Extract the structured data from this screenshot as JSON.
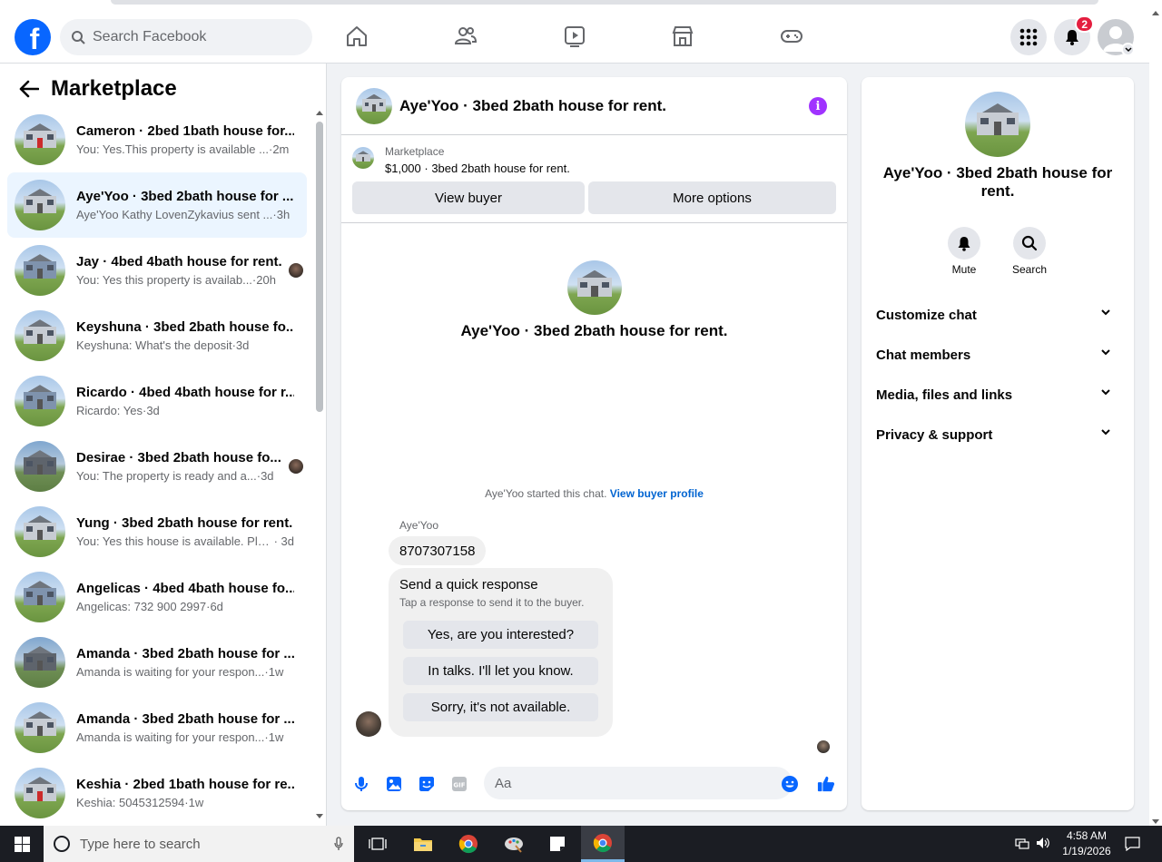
{
  "nav": {
    "search_placeholder": "Search Facebook",
    "notification_count": "2",
    "logo_letter": "f"
  },
  "sidebar": {
    "title": "Marketplace",
    "conversations": [
      {
        "name": "Cameron · 2bed 1bath house for...",
        "preview": "You: Yes.This property is available ...",
        "time": " ·2m",
        "house": "red",
        "active": false,
        "seen": false
      },
      {
        "name": "Aye'Yoo · 3bed 2bath house for ...",
        "preview": "Aye'Yoo Kathy LovenZykavius sent ...",
        "time": " ·3h",
        "house": "gray",
        "active": true,
        "seen": false
      },
      {
        "name": "Jay · 4bed 4bath house for rent.",
        "preview": "You: Yes this property is availab...",
        "time": " ·20h",
        "house": "blue",
        "active": false,
        "seen": true
      },
      {
        "name": "Keyshuna · 3bed 2bath house fo...",
        "preview": "Keyshuna: What's the deposit",
        "time": " ·3d",
        "house": "gray",
        "active": false,
        "seen": false
      },
      {
        "name": "Ricardo · 4bed 4bath house for r...",
        "preview": "Ricardo: Yes",
        "time": " ·3d",
        "house": "blue",
        "active": false,
        "seen": false
      },
      {
        "name": "Desirae · 3bed 2bath house fo...",
        "preview": "You: The property is ready and a...",
        "time": " ·3d",
        "house": "dark",
        "active": false,
        "seen": true
      },
      {
        "name": "Yung · 3bed 2bath house for rent.",
        "preview": "You: Yes this house is available. Ple...",
        "time": " · 3d",
        "house": "gray",
        "active": false,
        "seen": false
      },
      {
        "name": "Angelicas · 4bed 4bath house fo...",
        "preview": "Angelicas: 732 900 2997",
        "time": " ·6d",
        "house": "blue",
        "active": false,
        "seen": false
      },
      {
        "name": "Amanda · 3bed 2bath house for ...",
        "preview": "Amanda is waiting for your respon...",
        "time": " ·1w",
        "house": "dark",
        "active": false,
        "seen": false
      },
      {
        "name": "Amanda · 3bed 2bath house for ...",
        "preview": "Amanda is waiting for your respon...",
        "time": " ·1w",
        "house": "gray",
        "active": false,
        "seen": false
      },
      {
        "name": "Keshia · 2bed 1bath house for re...",
        "preview": "Keshia: 5045312594",
        "time": " ·1w",
        "house": "red",
        "active": false,
        "seen": false
      }
    ]
  },
  "chat": {
    "title": "Aye'Yoo · 3bed 2bath house for rent.",
    "listing_category": "Marketplace",
    "listing_price": "$1,000 · 3bed 2bath house for rent.",
    "view_buyer": "View buyer",
    "more_options": "More options",
    "intro_title": "Aye'Yoo · 3bed 2bath house for rent.",
    "started_text": "Aye'Yoo started this chat. ",
    "view_buyer_profile": "View buyer profile",
    "sender_name": "Aye'Yoo",
    "message": "8707307158",
    "quick_title": "Send a quick response",
    "quick_subtitle": "Tap a response to send it to the buyer.",
    "quick_options": [
      "Yes, are you interested?",
      "In talks. I'll let you know.",
      "Sorry, it's not available."
    ],
    "composer_placeholder": "Aa"
  },
  "details": {
    "title": "Aye'Yoo · 3bed 2bath house for rent.",
    "mute": "Mute",
    "search": "Search",
    "sections": [
      "Customize chat",
      "Chat members",
      "Media, files and links",
      "Privacy & support"
    ]
  },
  "taskbar": {
    "search_placeholder": "Type here to search",
    "time": "4:58 AM",
    "date": "1/19/2026"
  },
  "colors": {
    "brand": "#0866ff",
    "badge": "#e41e3f",
    "info": "#a033ff",
    "active_row": "#ebf5ff"
  }
}
